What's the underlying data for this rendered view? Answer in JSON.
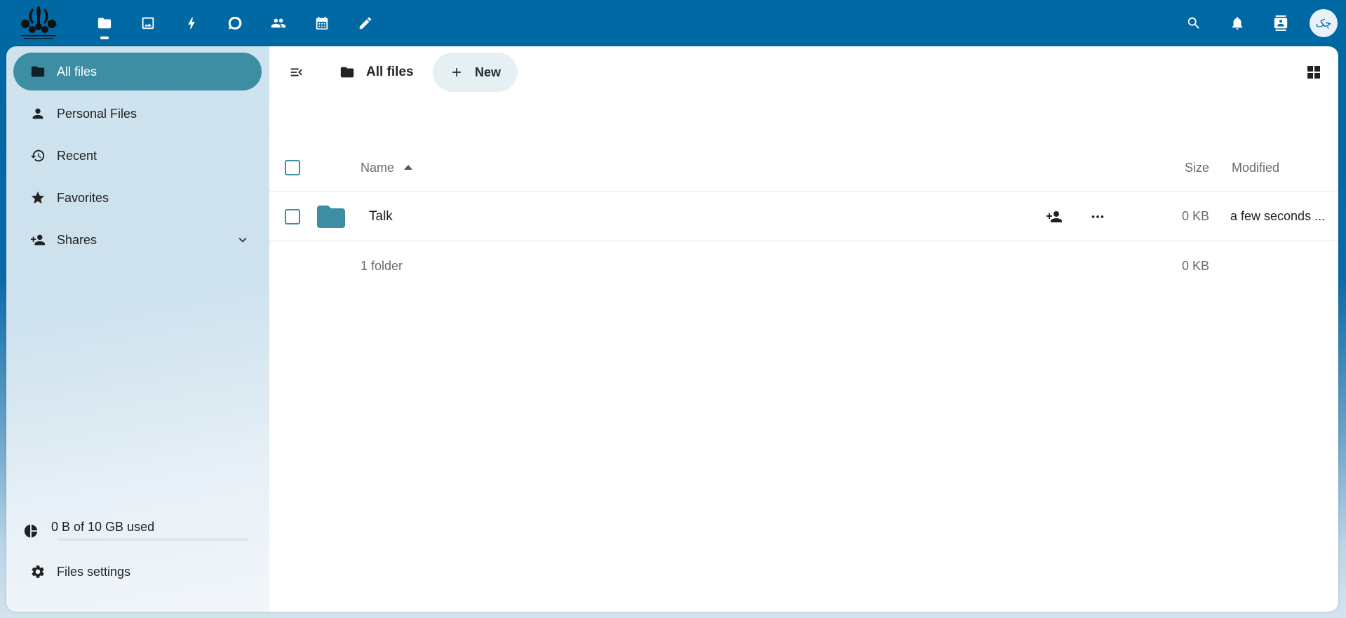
{
  "header": {
    "apps": [
      {
        "name": "files",
        "icon": "folder-icon",
        "active": true
      },
      {
        "name": "photos",
        "icon": "image-icon",
        "active": false
      },
      {
        "name": "activity",
        "icon": "lightning-icon",
        "active": false
      },
      {
        "name": "talk",
        "icon": "chat-icon",
        "active": false
      },
      {
        "name": "contacts",
        "icon": "contacts-icon",
        "active": false
      },
      {
        "name": "calendar",
        "icon": "calendar-icon",
        "active": false
      },
      {
        "name": "notes",
        "icon": "pencil-icon",
        "active": false
      }
    ],
    "avatar_initials": "چک"
  },
  "sidebar": {
    "items": [
      {
        "label": "All files",
        "icon": "folder-icon",
        "active": true
      },
      {
        "label": "Personal Files",
        "icon": "person-icon",
        "active": false
      },
      {
        "label": "Recent",
        "icon": "history-icon",
        "active": false
      },
      {
        "label": "Favorites",
        "icon": "star-icon",
        "active": false
      },
      {
        "label": "Shares",
        "icon": "share-icon",
        "active": false,
        "expandable": true
      }
    ],
    "quota": {
      "label": "0 B of 10 GB used",
      "used_fraction": 0
    },
    "settings_label": "Files settings"
  },
  "toolbar": {
    "breadcrumb": "All files",
    "new_label": "New"
  },
  "table": {
    "columns": {
      "name": "Name",
      "size": "Size",
      "modified": "Modified"
    },
    "rows": [
      {
        "name": "Talk",
        "type": "folder",
        "size": "0 KB",
        "modified": "a few seconds ..."
      }
    ],
    "summary": {
      "count": "1 folder",
      "total": "0 KB"
    }
  },
  "colors": {
    "header_bg": "#0068a3",
    "accent": "#3e8ea3"
  }
}
